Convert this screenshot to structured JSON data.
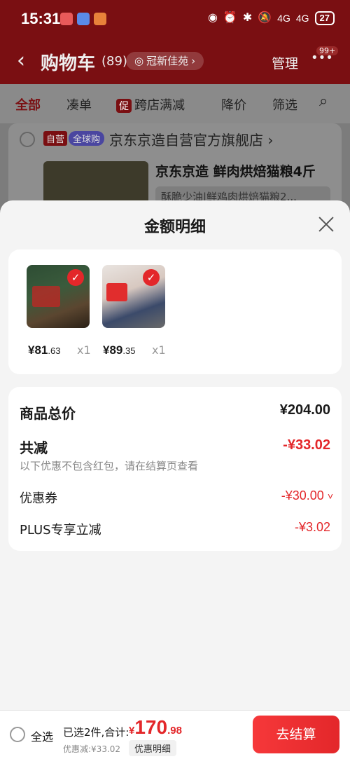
{
  "status": {
    "time": "15:31",
    "battery": "27",
    "net1": "4G",
    "net2": "4G"
  },
  "header": {
    "title": "购物车",
    "count": "(89)",
    "store_pill": "冠新佳苑",
    "manage": "管理",
    "badge": "99+"
  },
  "filters": {
    "all": "全部",
    "combine": "凑单",
    "promo_tag": "促",
    "cross_store": "跨店满减",
    "price_drop": "降价",
    "filter": "筛选"
  },
  "shop": {
    "tag_self": "自营",
    "tag_global": "全球购",
    "name": "京东京造自营官方旗舰店 ›",
    "product_title": "京东京造  鲜肉烘焙猫粮4斤",
    "product_sub": "酥脆少油|鲜鸡肉烘焙猫粮2..."
  },
  "sheet": {
    "title": "金额明细",
    "items": [
      {
        "price_int": "¥81",
        "price_dec": ".63",
        "qty": "x1"
      },
      {
        "price_int": "¥89",
        "price_dec": ".35",
        "qty": "x1"
      }
    ],
    "summary": {
      "total_label": "商品总价",
      "total_value": "¥204.00",
      "discount_label": "共减",
      "discount_value": "-¥33.02",
      "hint": "以下优惠不包含红包，请在结算页查看",
      "coupon_label": "优惠券",
      "coupon_value": "-¥30.00",
      "plus_label": "PLUS专享立减",
      "plus_value": "-¥3.02"
    }
  },
  "bottom": {
    "select_all": "全选",
    "selected_text": "已选2件,合计:",
    "yen": "¥",
    "total_int": "170",
    "total_dec": ".98",
    "discount": "优惠减:¥33.02",
    "detail_button": "优惠明细",
    "checkout": "去结算"
  }
}
